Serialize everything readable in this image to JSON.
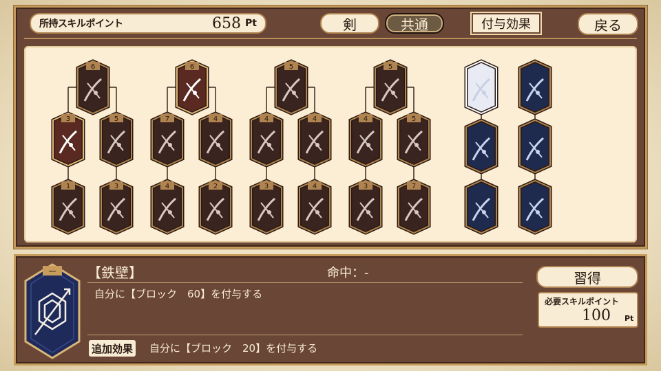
{
  "header": {
    "points_label": "所持スキルポイント",
    "points_value": "658",
    "points_unit": "Pt",
    "tab_sword": "剣",
    "tab_common": "共通",
    "tab_effect": "付与効果",
    "back": "戻る"
  },
  "colors": {
    "panel_brown": "#6a4636",
    "parchment": "#fbeed4",
    "sword_node": "#3a2420",
    "common_node": "#1e2a4e",
    "accent_red": "#c07070",
    "gold_border": "#c59a5a"
  },
  "tree": {
    "sword_groups": [
      {
        "top": {
          "cost": "6",
          "icon": "crescent-slash-icon"
        },
        "left": [
          {
            "cost": "3",
            "icon": "flame-slash-icon",
            "learned": true
          },
          {
            "cost": "1",
            "icon": "burst-icon"
          }
        ],
        "right": [
          {
            "cost": "5",
            "icon": "spiked-slash-icon"
          },
          {
            "cost": "3",
            "icon": "moon-slash-icon"
          }
        ]
      },
      {
        "top": {
          "cost": "6",
          "icon": "multi-slash-icon",
          "learned": true
        },
        "left": [
          {
            "cost": "7",
            "icon": "double-arc-icon"
          },
          {
            "cost": "4",
            "icon": "explosion-sword-icon"
          }
        ],
        "right": [
          {
            "cost": "4",
            "icon": "cross-slash-icon"
          },
          {
            "cost": "2",
            "icon": "x-arc-icon"
          }
        ]
      },
      {
        "top": {
          "cost": "5",
          "icon": "spin-slash-icon"
        },
        "left": [
          {
            "cost": "4",
            "icon": "triple-blade-icon"
          },
          {
            "cost": "3",
            "icon": "line-spark-icon"
          }
        ],
        "right": [
          {
            "cost": "4",
            "icon": "cross-blade-icon"
          },
          {
            "cost": "4",
            "icon": "crescent-sword-icon"
          }
        ]
      },
      {
        "top": {
          "cost": "5",
          "icon": "return-slash-icon"
        },
        "left": [
          {
            "cost": "4",
            "icon": "impact-sword-icon"
          },
          {
            "cost": "3",
            "icon": "circle-slash-icon"
          }
        ],
        "right": [
          {
            "cost": "5",
            "icon": "rain-blade-icon"
          },
          {
            "cost": "7",
            "icon": "storm-burst-icon"
          }
        ]
      }
    ],
    "common_columns": [
      [
        {
          "icon": "iron-wall-icon",
          "selected": true
        },
        {
          "icon": "arrow-up-shield-icon"
        },
        {
          "icon": "hexagon-ring-icon"
        }
      ],
      [
        {
          "icon": "sparkle-sword-icon"
        },
        {
          "icon": "flame-sword-icon"
        },
        {
          "icon": "radiant-sword-icon"
        }
      ]
    ]
  },
  "detail": {
    "name": "【鉄壁】",
    "hit": "命中：-",
    "card_icon": "iron-wall-icon",
    "card_mark": "一",
    "description": "自分に【ブロック　60】を付与する",
    "extra_label": "追加効果",
    "extra_description": "自分に【ブロック　20】を付与する",
    "learn_button": "習得",
    "required_label": "必要スキルポイント",
    "required_value": "100",
    "required_unit": "Pt"
  }
}
